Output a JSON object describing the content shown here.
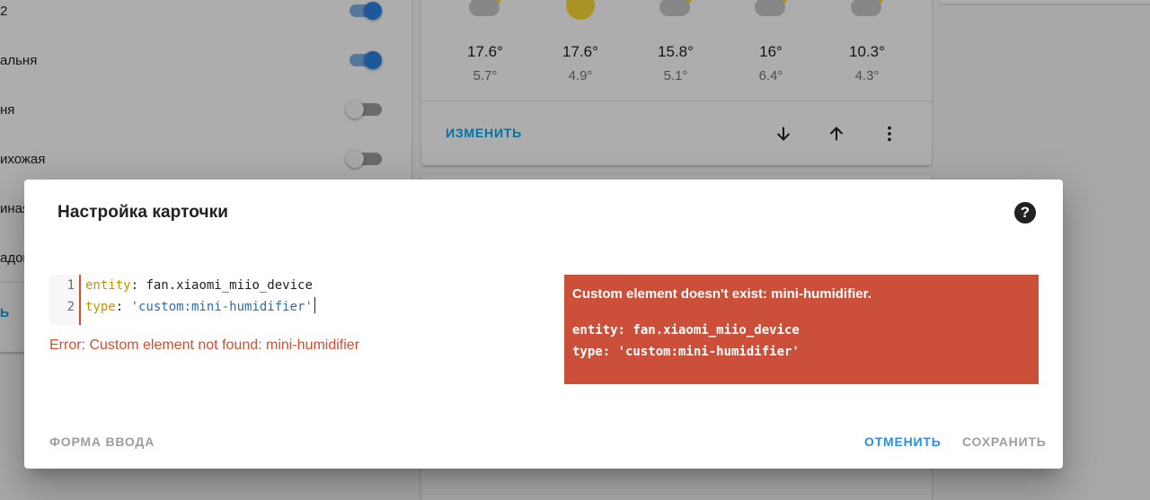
{
  "entities": [
    {
      "name": "2",
      "state": "on"
    },
    {
      "name": "альня",
      "state": "on"
    },
    {
      "name": "ня",
      "state": "off"
    },
    {
      "name": "ихожая",
      "state": "off"
    },
    {
      "name": "иная",
      "state": ""
    },
    {
      "name": "адов",
      "state": ""
    }
  ],
  "left_card_action": "Ь",
  "weather": {
    "forecast": [
      {
        "icon": "partly-cloudy-icon",
        "high": "17.6°",
        "low": "5.7°"
      },
      {
        "icon": "sunny-icon",
        "high": "17.6°",
        "low": "4.9°"
      },
      {
        "icon": "partly-cloudy-icon",
        "high": "15.8°",
        "low": "5.1°"
      },
      {
        "icon": "partly-cloudy-icon",
        "high": "16°",
        "low": "6.4°"
      },
      {
        "icon": "partly-cloudy-icon",
        "high": "10.3°",
        "low": "4.3°"
      }
    ],
    "edit_label": "ИЗМЕНИТЬ",
    "icons": {
      "move_down": "arrow-down-icon",
      "move_up": "arrow-up-icon",
      "menu": "more-vertical-icon"
    }
  },
  "dialog": {
    "title": "Настройка карточки",
    "help_icon": "help-circle-icon",
    "help_glyph": "?",
    "editor": {
      "lines": [
        {
          "number": "1",
          "key": "entity",
          "sep": ": ",
          "value": "fan.xiaomi_miio_device"
        },
        {
          "number": "2",
          "key": "type",
          "sep": ": ",
          "value": "'custom:mini-humidifier'"
        }
      ],
      "error": "Error: Custom element not found: mini-humidifier"
    },
    "preview": {
      "title": "Custom element doesn't exist: mini-humidifier.",
      "lines": [
        "entity: fan.xiaomi_miio_device",
        "type: 'custom:mini-humidifier'"
      ],
      "background": "#cc4f3a"
    },
    "actions": {
      "form_toggle": "ФОРМА ВВОДА",
      "cancel": "ОТМЕНИТЬ",
      "save": "СОХРАНИТЬ"
    }
  },
  "colors": {
    "accent": "#2b8ee4",
    "error": "#d84a2e",
    "toggle_on": "#2b84e3",
    "sun": "#fdd835"
  }
}
